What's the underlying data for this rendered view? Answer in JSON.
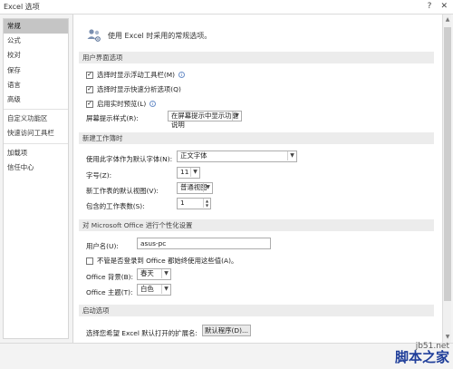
{
  "window": {
    "title": "Excel 选项",
    "help": "?",
    "close": "✕"
  },
  "sidebar": {
    "items": [
      {
        "label": "常规",
        "active": true
      },
      {
        "label": "公式"
      },
      {
        "label": "校对"
      },
      {
        "label": "保存"
      },
      {
        "label": "语言"
      },
      {
        "label": "高级"
      },
      {
        "label": "自定义功能区"
      },
      {
        "label": "快速访问工具栏"
      },
      {
        "label": "加载项"
      },
      {
        "label": "信任中心"
      }
    ]
  },
  "main": {
    "intro": "使用 Excel 时采用的常规选项。",
    "ui_section": {
      "header": "用户界面选项",
      "options": [
        {
          "label": "选择时显示浮动工具栏(M)",
          "checked": true
        },
        {
          "label": "选择时显示快速分析选项(Q)",
          "checked": true
        },
        {
          "label": "启用实时预览(L)",
          "checked": true
        }
      ],
      "screentip_label": "屏幕提示样式(R):",
      "screentip_value": "在屏幕提示中显示功能说明"
    },
    "new_wb_section": {
      "header": "新建工作簿时",
      "font_label": "使用此字体作为默认字体(N):",
      "font_value": "正文字体",
      "size_label": "字号(Z):",
      "size_value": "11",
      "view_label": "新工作表的默认视图(V):",
      "view_value": "普通视图",
      "sheets_label": "包含的工作表数(S):",
      "sheets_value": "1"
    },
    "personalize_section": {
      "header": "对 Microsoft Office 进行个性化设置",
      "username_label": "用户名(U):",
      "username_value": "asus-pc",
      "always_label": "不管是否登录到 Office 都始终使用这些值(A)。",
      "always_checked": false,
      "background_label": "Office 背景(B):",
      "background_value": "春天",
      "theme_label": "Office 主题(T):",
      "theme_value": "白色"
    },
    "startup_section": {
      "header": "启动选项",
      "ext_label": "选择您希望 Excel 默认打开的扩展名:",
      "default_programs_button": "默认程序(D)..."
    }
  },
  "watermark": {
    "url": "jb51.net",
    "brand": "脚本之家"
  },
  "colors": {
    "sidebar_active": "#c5c5c5",
    "section_header_bg": "#ececec",
    "watermark_brand": "#1f3e9a"
  }
}
